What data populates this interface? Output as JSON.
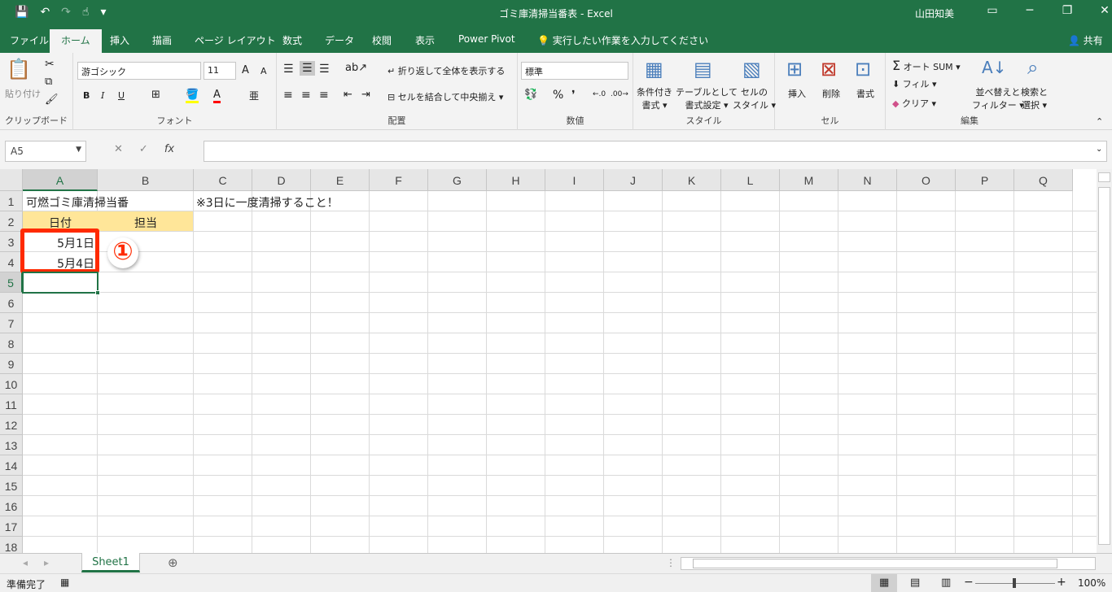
{
  "titlebar": {
    "title": "ゴミ庫清掃当番表  -  Excel",
    "user": "山田知美",
    "save_icon": "💾",
    "undo_icon": "↶",
    "redo_icon": "↷",
    "touch_icon": "☝",
    "customize_icon": "▾",
    "ribbon_display_icon": "▭",
    "minimize_icon": "─",
    "restore_icon": "❐",
    "close_icon": "✕"
  },
  "tabs": {
    "items": [
      "ファイル",
      "ホーム",
      "挿入",
      "描画",
      "ページ レイアウト",
      "数式",
      "データ",
      "校閲",
      "表示",
      "Power Pivot"
    ],
    "search": "実行したい作業を入力してください",
    "share": "共有"
  },
  "ribbon": {
    "clipboard": {
      "paste": "貼り付け",
      "label": "クリップボード"
    },
    "font": {
      "name": "游ゴシック",
      "size": "11",
      "bold": "B",
      "italic": "I",
      "underline": "U",
      "grow": "A",
      "shrink": "A",
      "color_a": "A",
      "label": "フォント"
    },
    "align": {
      "wrap": "折り返して全体を表示する",
      "merge": "セルを結合して中央揃え",
      "label": "配置"
    },
    "number": {
      "format": "標準",
      "percent": "%",
      "comma": "❜",
      "label": "数値"
    },
    "styles": {
      "cond": [
        "条件付き",
        "書式"
      ],
      "table": [
        "テーブルとして",
        "書式設定"
      ],
      "cell": [
        "セルの",
        "スタイル"
      ],
      "label": "スタイル"
    },
    "cells": {
      "insert": "挿入",
      "delete": "削除",
      "format": "書式",
      "label": "セル"
    },
    "editing": {
      "autosum": "オート SUM",
      "fill": "フィル",
      "clear": "クリア",
      "sort": [
        "並べ替えと",
        "フィルター"
      ],
      "find": [
        "検索と",
        "選択"
      ],
      "label": "編集"
    }
  },
  "formula": {
    "namebox": "A5",
    "fx": "fx",
    "cancel": "✕",
    "enter": "✓",
    "value": ""
  },
  "sheet": {
    "columns": [
      "A",
      "B",
      "C",
      "D",
      "E",
      "F",
      "G",
      "H",
      "I",
      "J",
      "K",
      "L",
      "M",
      "N",
      "O",
      "P",
      "Q"
    ],
    "rows": [
      "1",
      "2",
      "3",
      "4",
      "5",
      "6",
      "7",
      "8",
      "9",
      "10",
      "11",
      "12",
      "13",
      "14",
      "15",
      "16",
      "17",
      "18"
    ],
    "a1": "可燃ゴミ庫清掃当番",
    "c1": "※3日に一度清掃すること！",
    "a2": "日付",
    "b2": "担当",
    "a3": "5月1日",
    "a4": "5月4日",
    "callout": "①",
    "header_fill": "#ffe699",
    "highlight": "#ff2a00"
  },
  "bottombar": {
    "sheet_tab": "Sheet1",
    "add": "⊕"
  },
  "status": {
    "ready": "準備完了",
    "zoom": "100%"
  }
}
